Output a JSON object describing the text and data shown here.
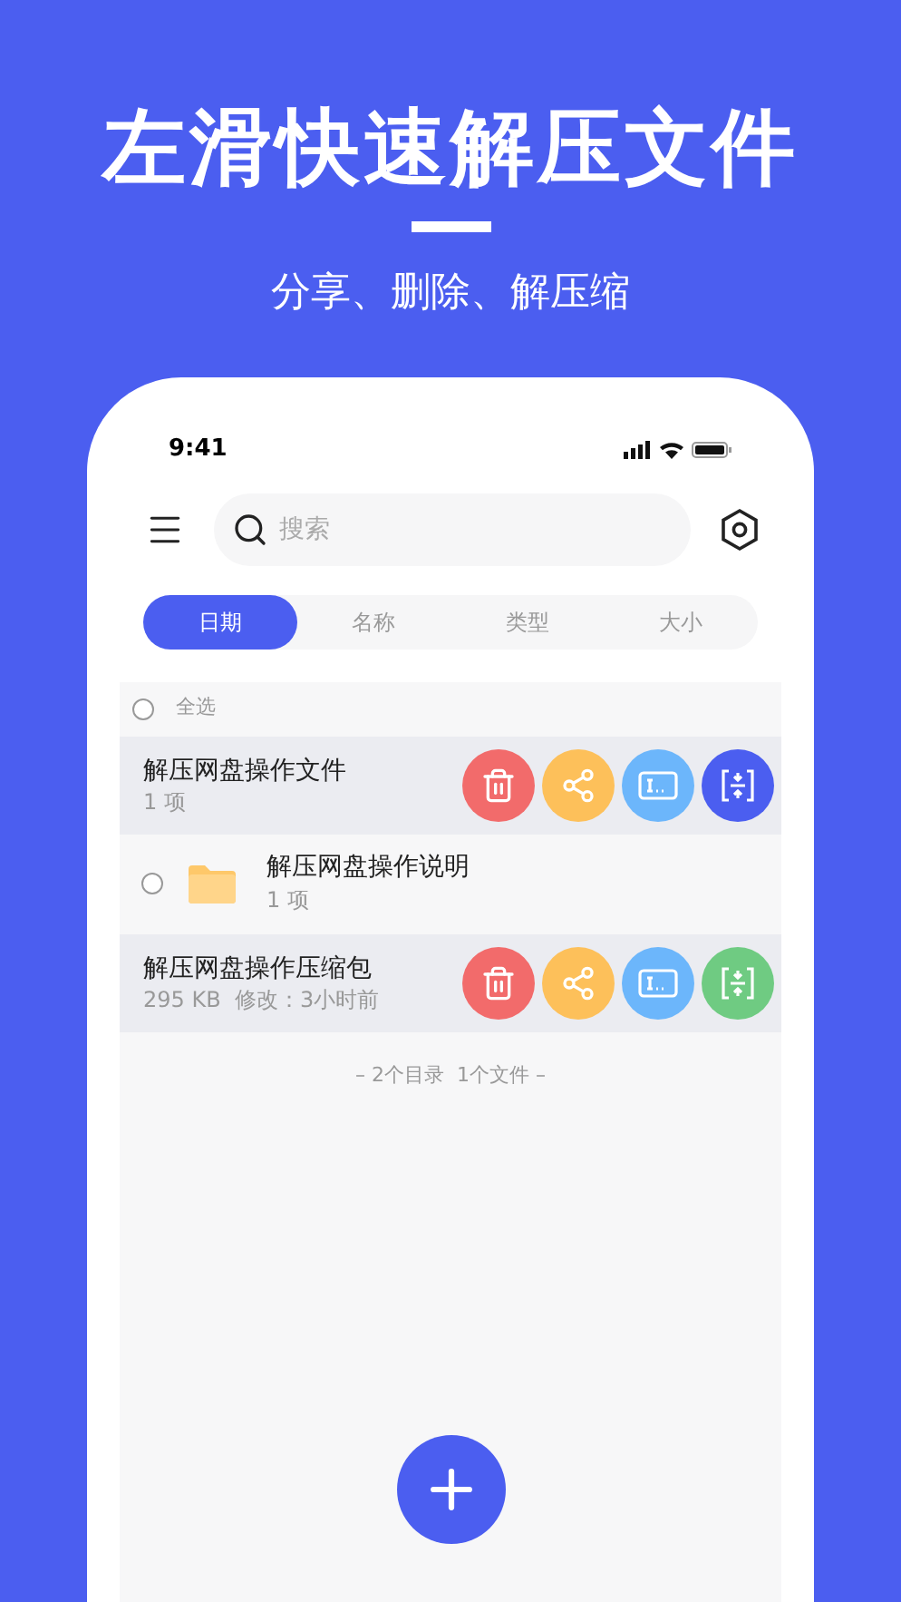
{
  "header": {
    "title": "左滑快速解压文件",
    "subtitle": "分享、删除、解压缩"
  },
  "status_bar": {
    "time": "9:41"
  },
  "search": {
    "placeholder": "搜索"
  },
  "tabs": [
    {
      "label": "日期",
      "selected": true
    },
    {
      "label": "名称",
      "selected": false
    },
    {
      "label": "类型",
      "selected": false
    },
    {
      "label": "大小",
      "selected": false
    }
  ],
  "select_all": {
    "label": "全选",
    "checked": false
  },
  "files": [
    {
      "kind": "swiped",
      "name": "解压网盘操作文件",
      "meta": "1 项",
      "actions": [
        {
          "kind": "delete",
          "color": "#f26b6b"
        },
        {
          "kind": "share",
          "color": "#fdc05a"
        },
        {
          "kind": "rename",
          "color": "#6cb6fb"
        },
        {
          "kind": "extract",
          "color": "#4b5ef0"
        }
      ]
    },
    {
      "kind": "folder",
      "name": "解压网盘操作说明",
      "meta": "1 项",
      "checked": false
    },
    {
      "kind": "swiped",
      "name": "解压网盘操作压缩包",
      "meta": "295 KB  修改：3小时前",
      "actions": [
        {
          "kind": "delete",
          "color": "#f26b6b"
        },
        {
          "kind": "share",
          "color": "#fdc05a"
        },
        {
          "kind": "rename",
          "color": "#6cb6fb"
        },
        {
          "kind": "extract",
          "color": "#6fcb82"
        }
      ]
    }
  ],
  "footer": "– 2个目录  1个文件 –"
}
